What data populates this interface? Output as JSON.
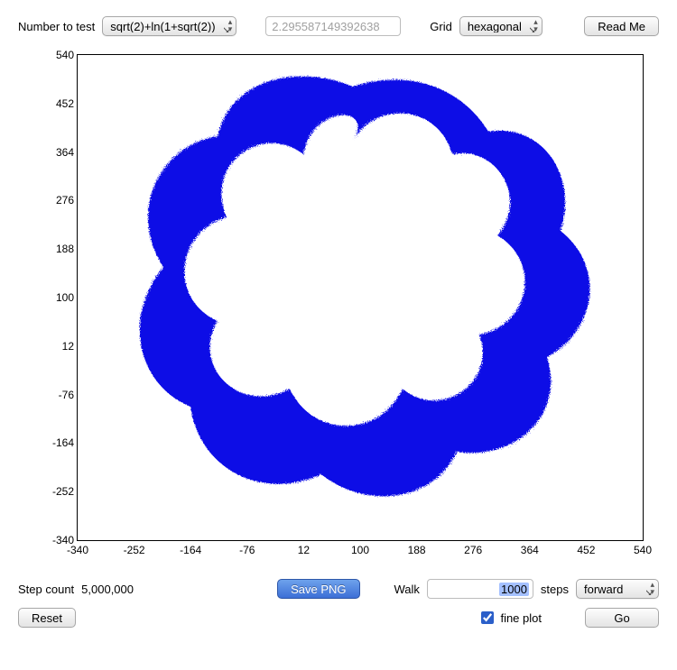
{
  "top": {
    "number_label": "Number to test",
    "number_select": "sqrt(2)+ln(1+sqrt(2))",
    "number_value": "2.295587149392638",
    "grid_label": "Grid",
    "grid_select": "hexagonal",
    "readme_label": "Read Me"
  },
  "plot": {
    "y_ticks": [
      "540",
      "452",
      "364",
      "276",
      "188",
      "100",
      "12",
      "-76",
      "-164",
      "-252",
      "-340"
    ],
    "x_ticks": [
      "-340",
      "-252",
      "-164",
      "-76",
      "12",
      "100",
      "188",
      "276",
      "364",
      "452",
      "540"
    ]
  },
  "bottom": {
    "step_count_label": "Step count",
    "step_count_value": "5,000,000",
    "save_png_label": "Save PNG",
    "walk_label": "Walk",
    "walk_value": "1000",
    "steps_text": "steps",
    "direction_select": "forward",
    "reset_label": "Reset",
    "fineplot_label": "fine plot",
    "fineplot_checked": true,
    "go_label": "Go"
  }
}
